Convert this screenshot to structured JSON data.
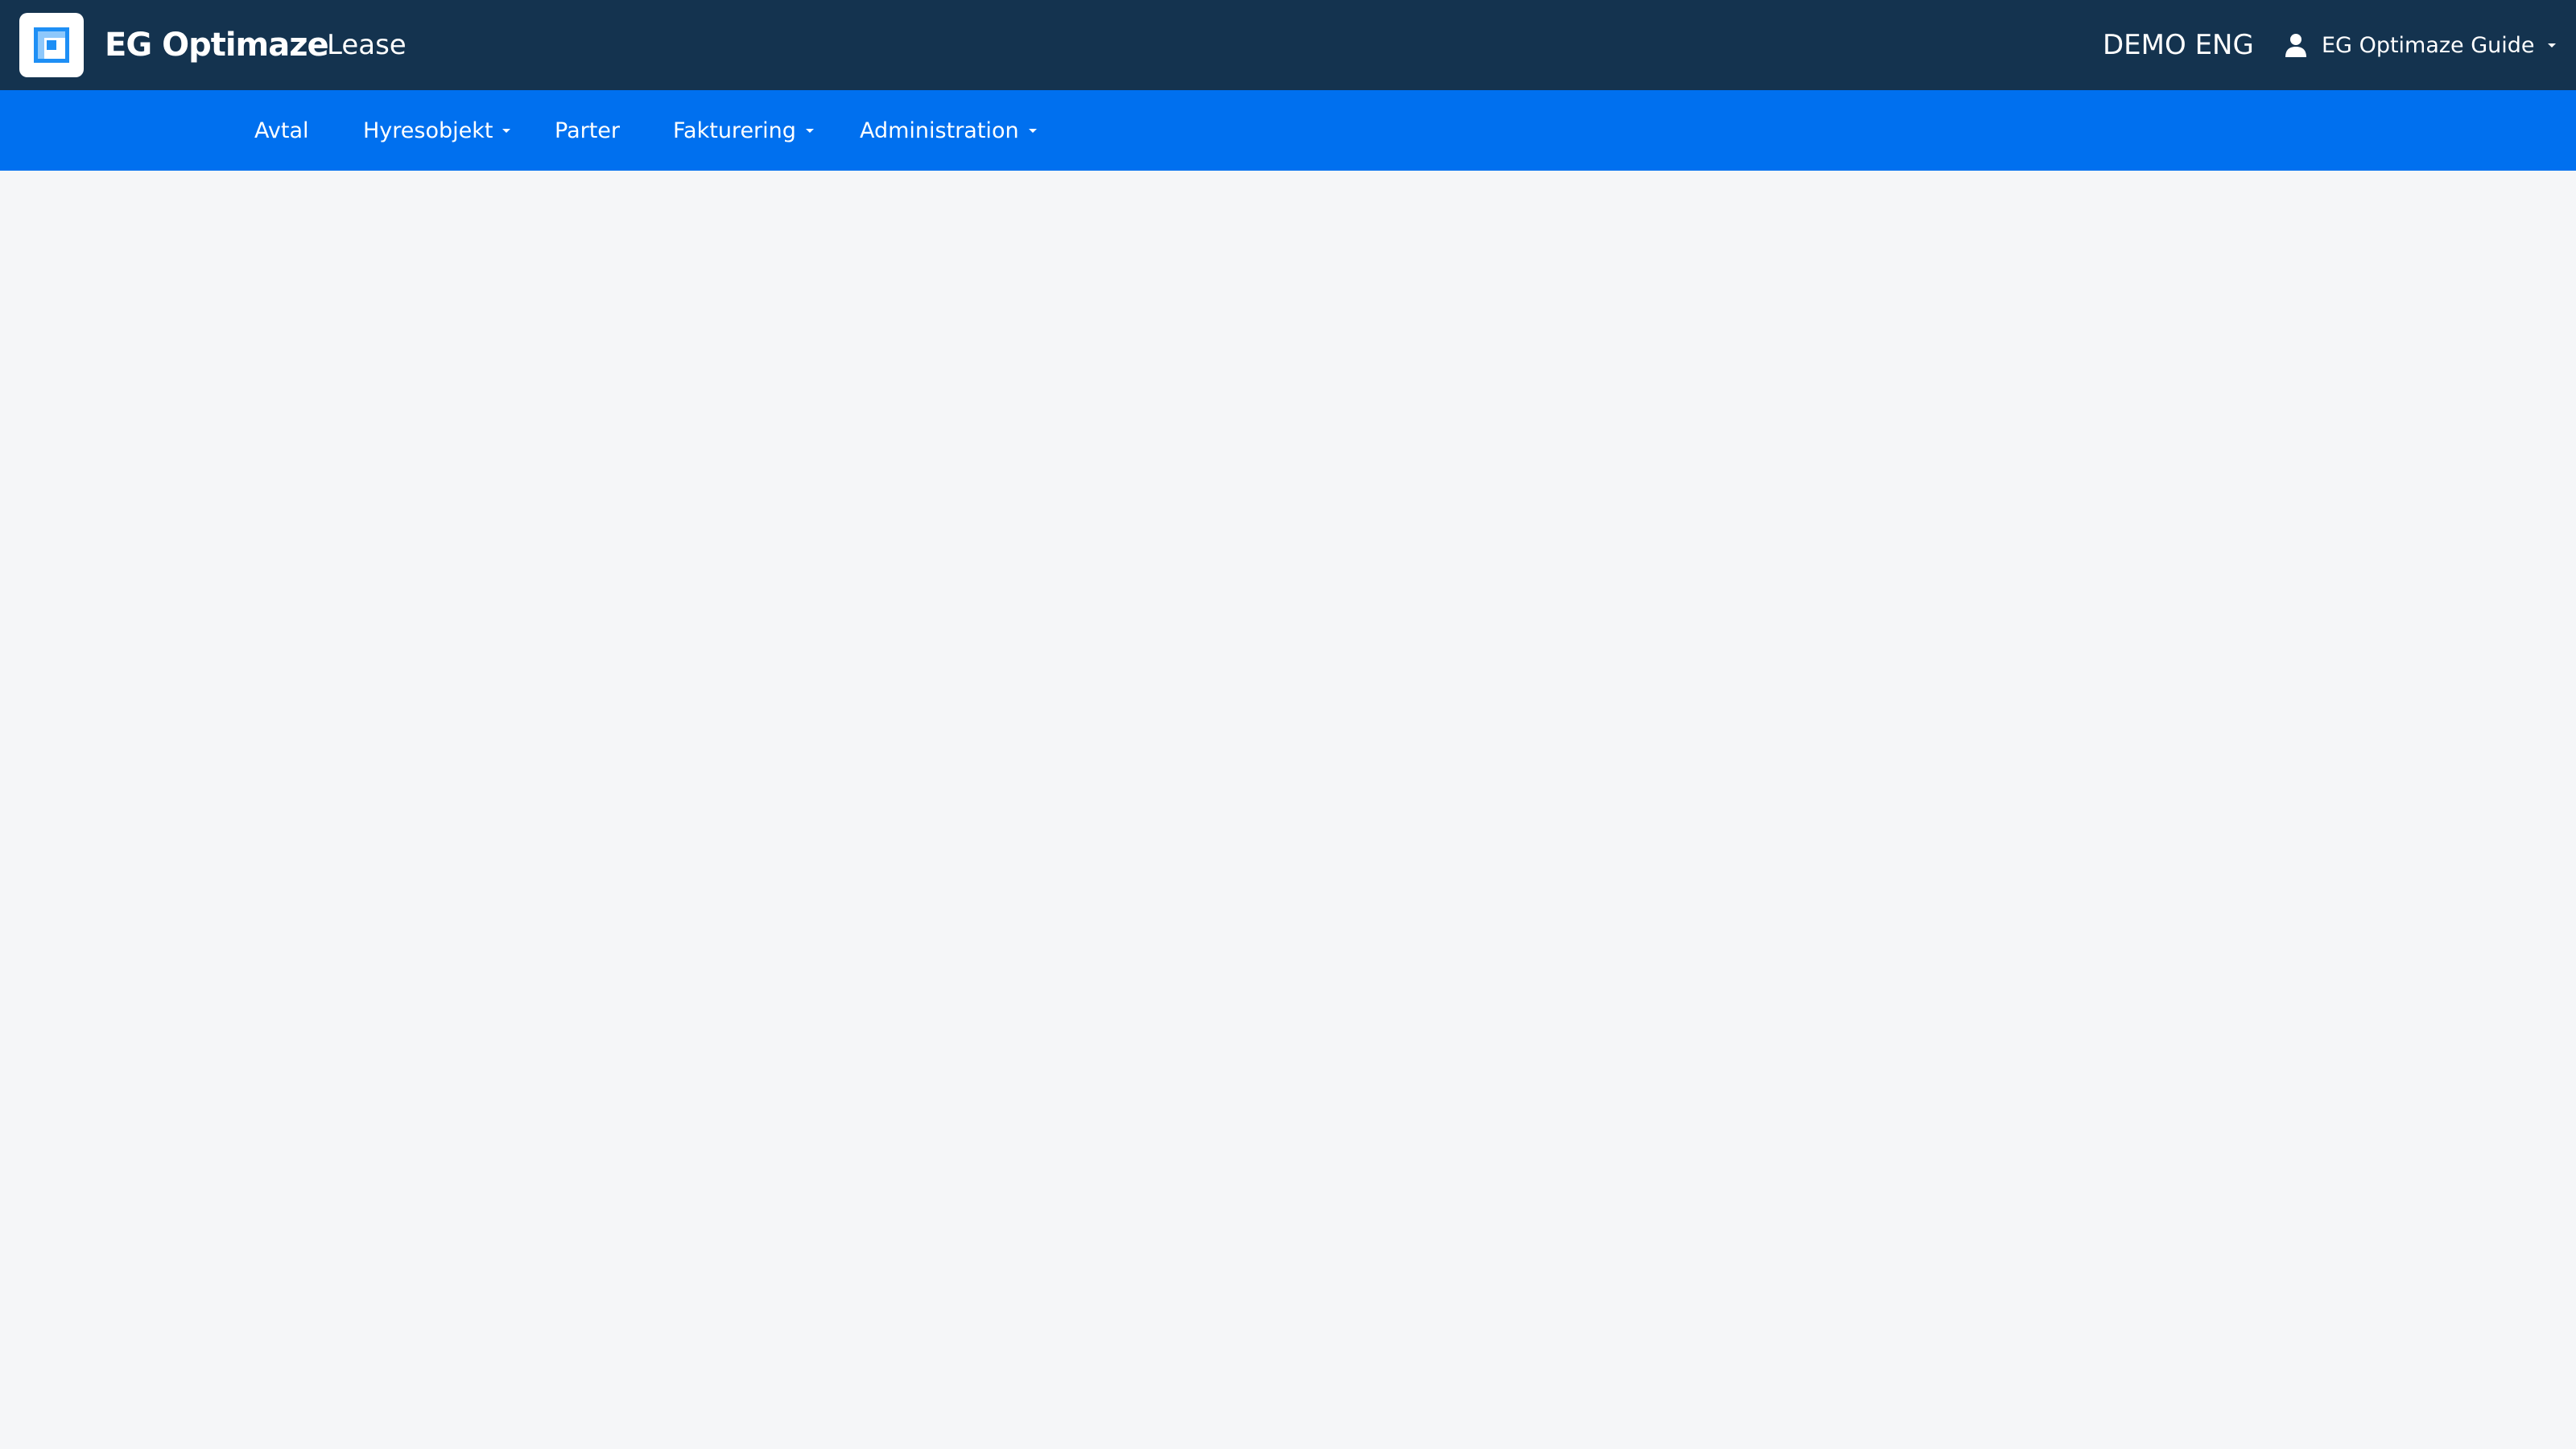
{
  "header": {
    "brand": "EG Optimaze",
    "app_name": "Lease",
    "organization": "DEMO ENG",
    "user_menu": {
      "label": "EG Optimaze Guide",
      "icon": "person-icon",
      "dropdown_icon": "caret-down-icon"
    }
  },
  "nav": {
    "items": [
      {
        "label": "Avtal",
        "has_dropdown": false
      },
      {
        "label": "Hyresobjekt",
        "has_dropdown": true
      },
      {
        "label": "Parter",
        "has_dropdown": false
      },
      {
        "label": "Fakturering",
        "has_dropdown": true
      },
      {
        "label": "Administration",
        "has_dropdown": true
      }
    ]
  },
  "colors": {
    "header_bg": "#14334f",
    "nav_bg": "#0070ef",
    "content_bg": "#f5f6f8",
    "logo_accent": "#1e8ff5",
    "text_on_dark": "#ffffff"
  }
}
